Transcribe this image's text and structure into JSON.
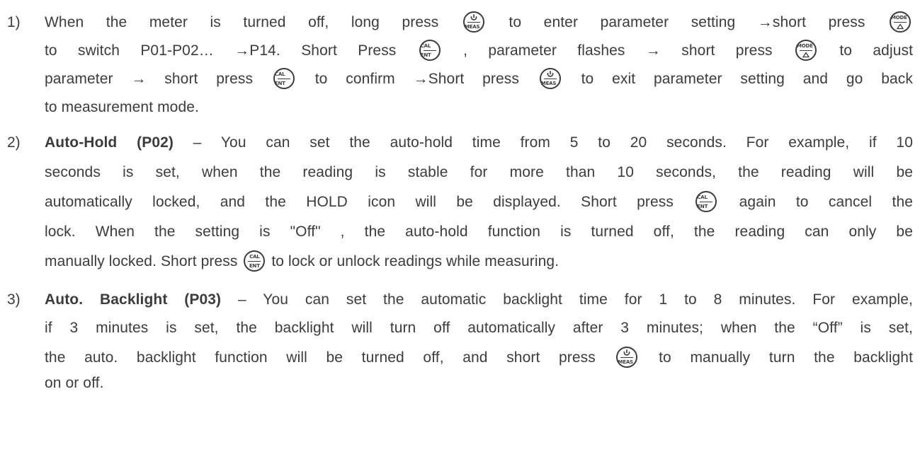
{
  "buttons": {
    "meas": {
      "icon": "power-icon",
      "label": "MEAS"
    },
    "mode": {
      "label": "MODE",
      "icon": "triangle-up-icon"
    },
    "cal": {
      "top": "CAL",
      "bottom": "ENT"
    }
  },
  "items": [
    {
      "number": "1)",
      "l1": [
        "When the meter is turned off, long press",
        "to enter parameter setting →short press"
      ],
      "l2": [
        "to switch P01-P02… →P14. Short Press",
        ", parameter flashes → short press",
        "to adjust"
      ],
      "l3": [
        "parameter → short press",
        "to confirm →Short press",
        "to exit parameter setting and go back"
      ],
      "l4": "to measurement mode."
    },
    {
      "number": "2)",
      "title": "Auto-Hold (P02)",
      "l1": " – You can set the auto-hold time from 5 to 20 seconds. For example, if 10",
      "l2": "seconds is set, when the reading is stable for more than 10 seconds, the reading will be",
      "l3": [
        "automatically locked, and the HOLD icon will be displayed. Short press",
        "again to cancel the"
      ],
      "l4": "lock. When the setting is \"Off\" , the auto-hold function is turned off, the reading can only be",
      "l5": [
        "manually locked. Short press",
        "to lock or unlock readings while measuring."
      ]
    },
    {
      "number": "3)",
      "title": "Auto. Backlight (P03)",
      "l1": " – You can set the automatic backlight time for 1 to 8 minutes. For example,",
      "l2": "if 3 minutes is set, the backlight will turn off automatically after 3 minutes; when the “Off” is set,",
      "l3": [
        "the auto. backlight function will be turned off, and short press",
        "to manually turn the backlight"
      ],
      "l4": "on or off."
    }
  ]
}
